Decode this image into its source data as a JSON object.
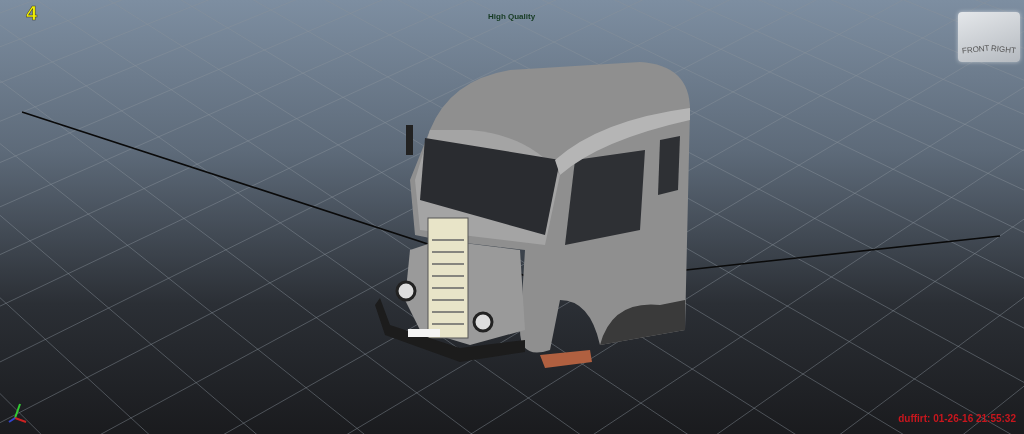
{
  "viewport": {
    "frame_label": "4",
    "quality_label": "High Quality",
    "view_cube": {
      "faces": [
        "FRONT",
        "RIGHT"
      ]
    },
    "stamp": "duffirt: 01-26-16 21:55:32"
  }
}
